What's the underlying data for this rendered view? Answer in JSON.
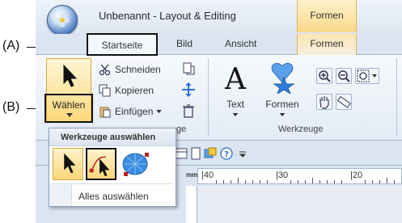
{
  "window": {
    "title": "Unbenannt - Layout & Editing",
    "contextual_tab_title": "Formen"
  },
  "tabs": {
    "items": [
      {
        "label": "Startseite",
        "active": true
      },
      {
        "label": "Bild"
      },
      {
        "label": "Ansicht"
      }
    ],
    "contextual": "Formen"
  },
  "ribbon": {
    "select_button_label": "Wählen",
    "clipboard": {
      "cut": "Schneiden",
      "copy": "Kopieren",
      "paste": "Einfügen"
    },
    "text_button": "Text",
    "shapes_button": "Formen",
    "group_tools_label": "Werkzeuge",
    "group_clipboard_partial": "ge"
  },
  "dropdown": {
    "header": "Werkzeuge auswählen",
    "select_all": "Alles auswählen"
  },
  "ruler": {
    "unit": "mm",
    "labels": [
      "|40",
      "|30",
      "|20"
    ]
  },
  "callouts": {
    "a": "(A)",
    "b": "(B)"
  },
  "colors": {
    "accent": "#fcd779",
    "ribbon_bg": "#dbe5f1",
    "highlight_border": "#111111"
  }
}
